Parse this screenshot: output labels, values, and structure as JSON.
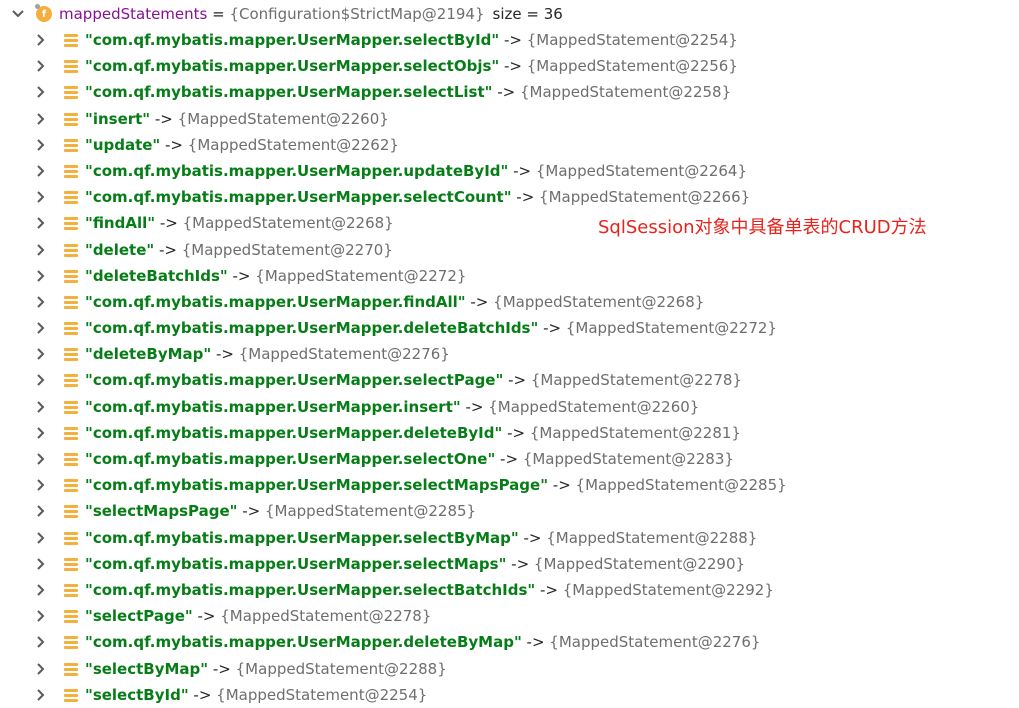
{
  "root": {
    "field_icon_letter": "f",
    "name": "mappedStatements",
    "equals": " = ",
    "value": "{Configuration$StrictMap@2194}",
    "size": "size = 36"
  },
  "arrow": " -> ",
  "entries": [
    {
      "key": "\"com.qf.mybatis.mapper.UserMapper.selectById\"",
      "value": "{MappedStatement@2254}"
    },
    {
      "key": "\"com.qf.mybatis.mapper.UserMapper.selectObjs\"",
      "value": "{MappedStatement@2256}"
    },
    {
      "key": "\"com.qf.mybatis.mapper.UserMapper.selectList\"",
      "value": "{MappedStatement@2258}"
    },
    {
      "key": "\"insert\"",
      "value": "{MappedStatement@2260}"
    },
    {
      "key": "\"update\"",
      "value": "{MappedStatement@2262}"
    },
    {
      "key": "\"com.qf.mybatis.mapper.UserMapper.updateById\"",
      "value": "{MappedStatement@2264}"
    },
    {
      "key": "\"com.qf.mybatis.mapper.UserMapper.selectCount\"",
      "value": "{MappedStatement@2266}"
    },
    {
      "key": "\"findAll\"",
      "value": "{MappedStatement@2268}"
    },
    {
      "key": "\"delete\"",
      "value": "{MappedStatement@2270}"
    },
    {
      "key": "\"deleteBatchIds\"",
      "value": "{MappedStatement@2272}"
    },
    {
      "key": "\"com.qf.mybatis.mapper.UserMapper.findAll\"",
      "value": "{MappedStatement@2268}"
    },
    {
      "key": "\"com.qf.mybatis.mapper.UserMapper.deleteBatchIds\"",
      "value": "{MappedStatement@2272}"
    },
    {
      "key": "\"deleteByMap\"",
      "value": "{MappedStatement@2276}"
    },
    {
      "key": "\"com.qf.mybatis.mapper.UserMapper.selectPage\"",
      "value": "{MappedStatement@2278}"
    },
    {
      "key": "\"com.qf.mybatis.mapper.UserMapper.insert\"",
      "value": "{MappedStatement@2260}"
    },
    {
      "key": "\"com.qf.mybatis.mapper.UserMapper.deleteById\"",
      "value": "{MappedStatement@2281}"
    },
    {
      "key": "\"com.qf.mybatis.mapper.UserMapper.selectOne\"",
      "value": "{MappedStatement@2283}"
    },
    {
      "key": "\"com.qf.mybatis.mapper.UserMapper.selectMapsPage\"",
      "value": "{MappedStatement@2285}"
    },
    {
      "key": "\"selectMapsPage\"",
      "value": "{MappedStatement@2285}"
    },
    {
      "key": "\"com.qf.mybatis.mapper.UserMapper.selectByMap\"",
      "value": "{MappedStatement@2288}"
    },
    {
      "key": "\"com.qf.mybatis.mapper.UserMapper.selectMaps\"",
      "value": "{MappedStatement@2290}"
    },
    {
      "key": "\"com.qf.mybatis.mapper.UserMapper.selectBatchIds\"",
      "value": "{MappedStatement@2292}"
    },
    {
      "key": "\"selectPage\"",
      "value": "{MappedStatement@2278}"
    },
    {
      "key": "\"com.qf.mybatis.mapper.UserMapper.deleteByMap\"",
      "value": "{MappedStatement@2276}"
    },
    {
      "key": "\"selectByMap\"",
      "value": "{MappedStatement@2288}"
    },
    {
      "key": "\"selectById\"",
      "value": "{MappedStatement@2254}"
    }
  ],
  "annotation": "SqlSession对象中具备单表的CRUD方法",
  "colors": {
    "key": "#067d17",
    "value": "#6e6e6e",
    "field_name": "#871094",
    "icon": "#f4af3d",
    "annotation": "#e8231c"
  },
  "icons": {
    "expanded": "chevron-down-icon",
    "collapsed": "chevron-right-icon",
    "field": "field-icon",
    "entry": "map-entry-icon"
  }
}
